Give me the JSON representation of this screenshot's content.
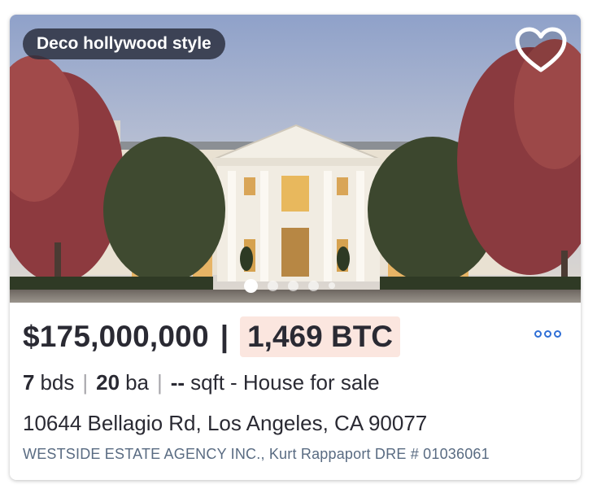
{
  "listing": {
    "tag": "Deco hollywood style",
    "price": "$175,000,000",
    "separator": "|",
    "btc_price": "1,469 BTC",
    "beds_value": "7",
    "beds_label": "bds",
    "baths_value": "20",
    "baths_label": "ba",
    "sqft_value": "--",
    "sqft_label": "sqft",
    "type_text": "- House for sale",
    "address": "10644 Bellagio Rd, Los Angeles, CA 90077",
    "agency": "WESTSIDE ESTATE AGENCY INC., Kurt Rappaport DRE # 01036061"
  },
  "carousel": {
    "total_dots": 5,
    "active_index": 0
  },
  "icons": {
    "favorite": "heart-outline-icon",
    "more": "more-dots-icon"
  },
  "colors": {
    "btc_highlight": "#fbe6df",
    "accent_blue": "#2f6fd6",
    "text": "#2a2a33",
    "agency_text": "#596b82"
  }
}
